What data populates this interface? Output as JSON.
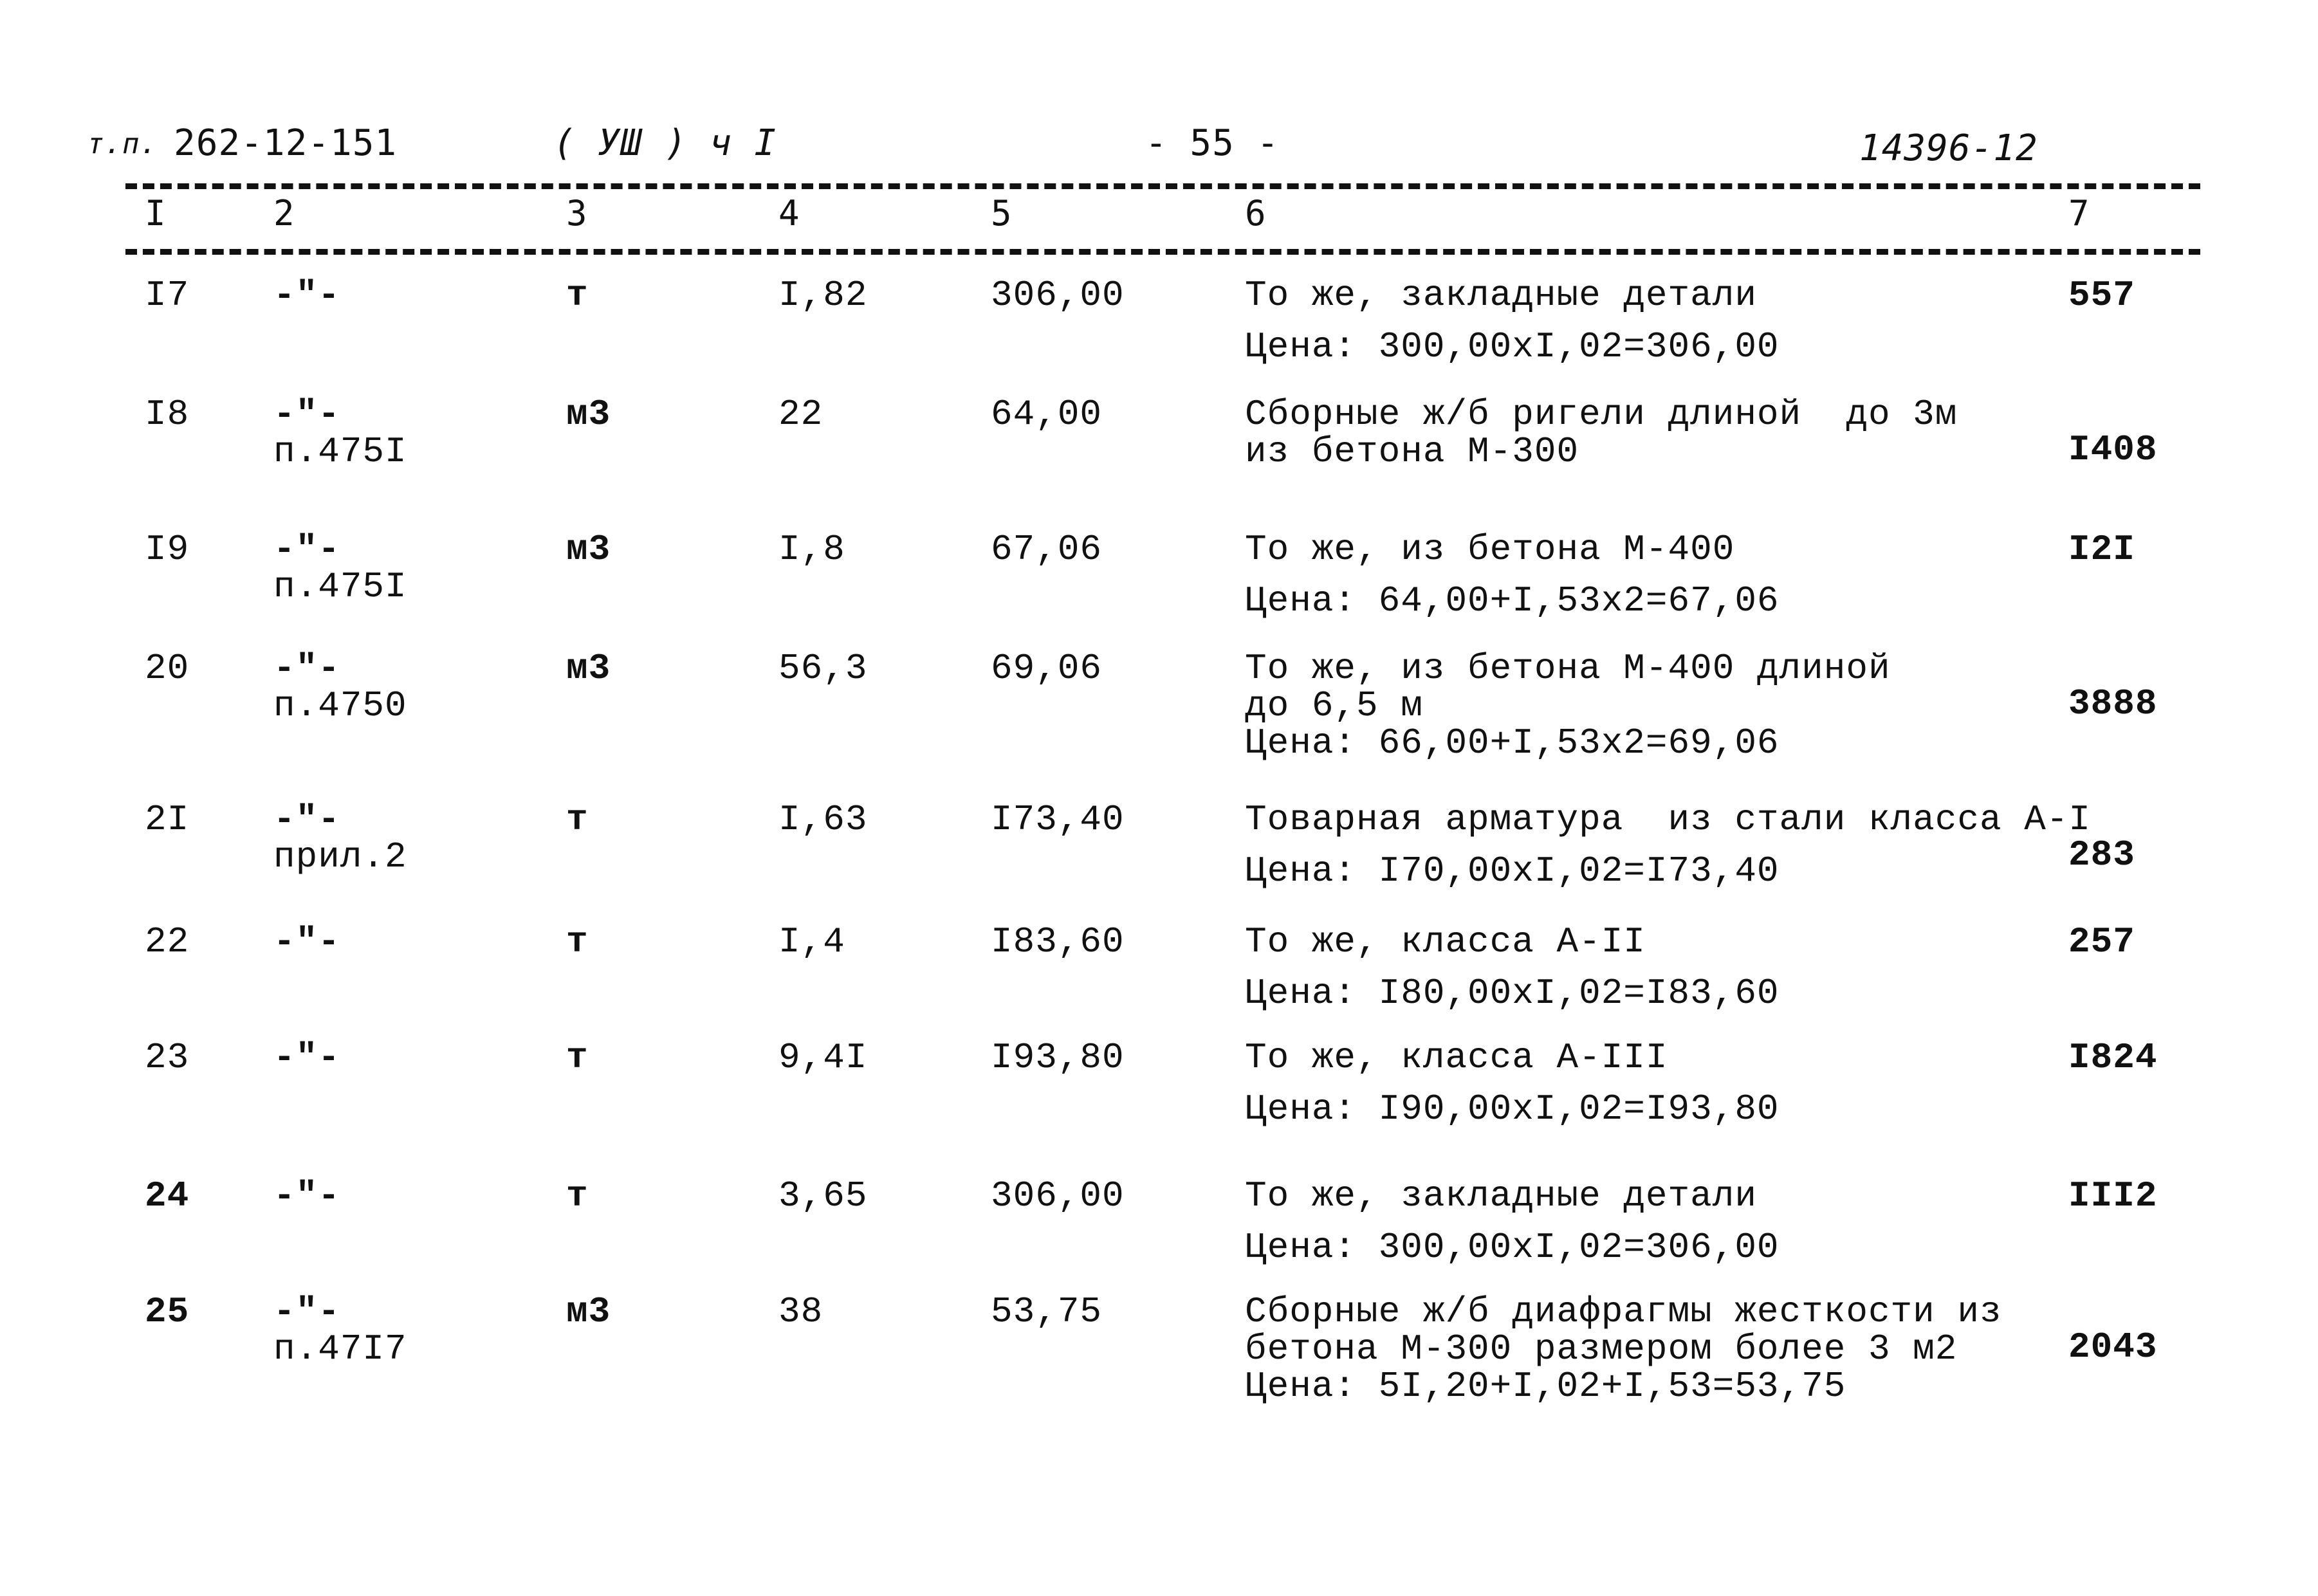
{
  "header": {
    "doc_prefix": "т.п.",
    "doc_code": "262-12-151",
    "section": "( УШ ) ч I",
    "page": "- 55 -",
    "inventory": "14396-12"
  },
  "columns": [
    "I",
    "2",
    "3",
    "4",
    "5",
    "6",
    "7"
  ],
  "rows": [
    {
      "no": "I7",
      "ref": [
        "-\"-"
      ],
      "unit": "т",
      "qty": "I,82",
      "price": "306,00",
      "desc": [
        "То же, закладные детали",
        "Цена: 300,00xI,02=306,00"
      ],
      "desc_gap": true,
      "total": "557"
    },
    {
      "no": "I8",
      "ref": [
        "-\"-",
        "п.475I"
      ],
      "unit": "м3",
      "qty": "22",
      "price": "64,00",
      "desc": [
        "Сборные ж/б ригели длиной  до 3м",
        "из бетона М-300"
      ],
      "desc_gap": false,
      "total": "I408"
    },
    {
      "no": "I9",
      "ref": [
        "-\"-",
        "п.475I"
      ],
      "unit": "м3",
      "qty": "I,8",
      "price": "67,06",
      "desc": [
        "То же, из бетона М-400",
        "Цена: 64,00+I,53x2=67,06"
      ],
      "desc_gap": true,
      "total": "I2I"
    },
    {
      "no": "20",
      "ref": [
        "-\"-",
        "п.4750"
      ],
      "unit": "м3",
      "qty": "56,3",
      "price": "69,06",
      "desc": [
        "То же, из бетона М-400 длиной",
        "до 6,5 м",
        "Цена: 66,00+I,53x2=69,06"
      ],
      "desc_gap": false,
      "total": "3888"
    },
    {
      "no": "2I",
      "ref": [
        "-\"-",
        "прил.2"
      ],
      "unit": "т",
      "qty": "I,63",
      "price": "I73,40",
      "desc": [
        "Товарная арматура  из стали класса А-I",
        "Цена: I70,00xI,02=I73,40"
      ],
      "desc_gap": true,
      "total": "283"
    },
    {
      "no": "22",
      "ref": [
        "-\"-"
      ],
      "unit": "т",
      "qty": "I,4",
      "price": "I83,60",
      "desc": [
        "То же, класса А-II",
        "Цена: I80,00xI,02=I83,60"
      ],
      "desc_gap": true,
      "total": "257"
    },
    {
      "no": "23",
      "ref": [
        "-\"-"
      ],
      "unit": "т",
      "qty": "9,4I",
      "price": "I93,80",
      "desc": [
        "То же, класса А-III",
        "Цена: I90,00xI,02=I93,80"
      ],
      "desc_gap": true,
      "total": "I824"
    },
    {
      "no": "24",
      "ref": [
        "-\"-"
      ],
      "unit": "т",
      "qty": "3,65",
      "price": "306,00",
      "desc": [
        "То же, закладные детали",
        "Цена: 300,00xI,02=306,00"
      ],
      "desc_gap": true,
      "total": "III2"
    },
    {
      "no": "25",
      "ref": [
        "-\"-",
        "п.47I7"
      ],
      "unit": "м3",
      "qty": "38",
      "price": "53,75",
      "desc": [
        "Сборные ж/б диафрагмы жесткости из",
        "бетона М-300 размером более 3 м2",
        "Цена: 5I,20+I,02+I,53=53,75"
      ],
      "desc_gap": false,
      "total": "2043"
    }
  ]
}
